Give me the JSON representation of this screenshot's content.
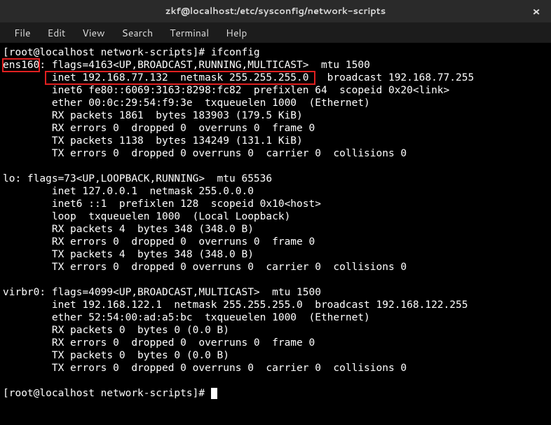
{
  "titlebar": {
    "title": "zkf@localhost:/etc/sysconfig/network-scripts"
  },
  "menubar": {
    "file": "File",
    "edit": "Edit",
    "view": "View",
    "search": "Search",
    "terminal": "Terminal",
    "help": "Help"
  },
  "terminal": {
    "prompt1": "[root@localhost network-scripts]# ",
    "cmd1": "ifconfig",
    "ens160_name": "ens160",
    "ens160_flags": ": flags=4163<UP,BROADCAST,RUNNING,MULTICAST>  mtu 1500",
    "ens160_inet_box": " inet 192.168.77.132  netmask 255.255.255.0 ",
    "ens160_inet_rest": "  broadcast 192.168.77.255",
    "ens160_inet6": "        inet6 fe80::6069:3163:8298:fc82  prefixlen 64  scopeid 0x20<link>",
    "ens160_ether": "        ether 00:0c:29:54:f9:3e  txqueuelen 1000  (Ethernet)",
    "ens160_rxp": "        RX packets 1861  bytes 183903 (179.5 KiB)",
    "ens160_rxe": "        RX errors 0  dropped 0  overruns 0  frame 0",
    "ens160_txp": "        TX packets 1138  bytes 134249 (131.1 KiB)",
    "ens160_txe": "        TX errors 0  dropped 0 overruns 0  carrier 0  collisions 0",
    "lo_head": "lo: flags=73<UP,LOOPBACK,RUNNING>  mtu 65536",
    "lo_inet": "        inet 127.0.0.1  netmask 255.0.0.0",
    "lo_inet6": "        inet6 ::1  prefixlen 128  scopeid 0x10<host>",
    "lo_loop": "        loop  txqueuelen 1000  (Local Loopback)",
    "lo_rxp": "        RX packets 4  bytes 348 (348.0 B)",
    "lo_rxe": "        RX errors 0  dropped 0  overruns 0  frame 0",
    "lo_txp": "        TX packets 4  bytes 348 (348.0 B)",
    "lo_txe": "        TX errors 0  dropped 0 overruns 0  carrier 0  collisions 0",
    "virbr0_head": "virbr0: flags=4099<UP,BROADCAST,MULTICAST>  mtu 1500",
    "virbr0_inet": "        inet 192.168.122.1  netmask 255.255.255.0  broadcast 192.168.122.255",
    "virbr0_ether": "        ether 52:54:00:ad:a5:bc  txqueuelen 1000  (Ethernet)",
    "virbr0_rxp": "        RX packets 0  bytes 0 (0.0 B)",
    "virbr0_rxe": "        RX errors 0  dropped 0  overruns 0  frame 0",
    "virbr0_txp": "        TX packets 0  bytes 0 (0.0 B)",
    "virbr0_txe": "        TX errors 0  dropped 0 overruns 0  carrier 0  collisions 0",
    "prompt2": "[root@localhost network-scripts]# "
  }
}
